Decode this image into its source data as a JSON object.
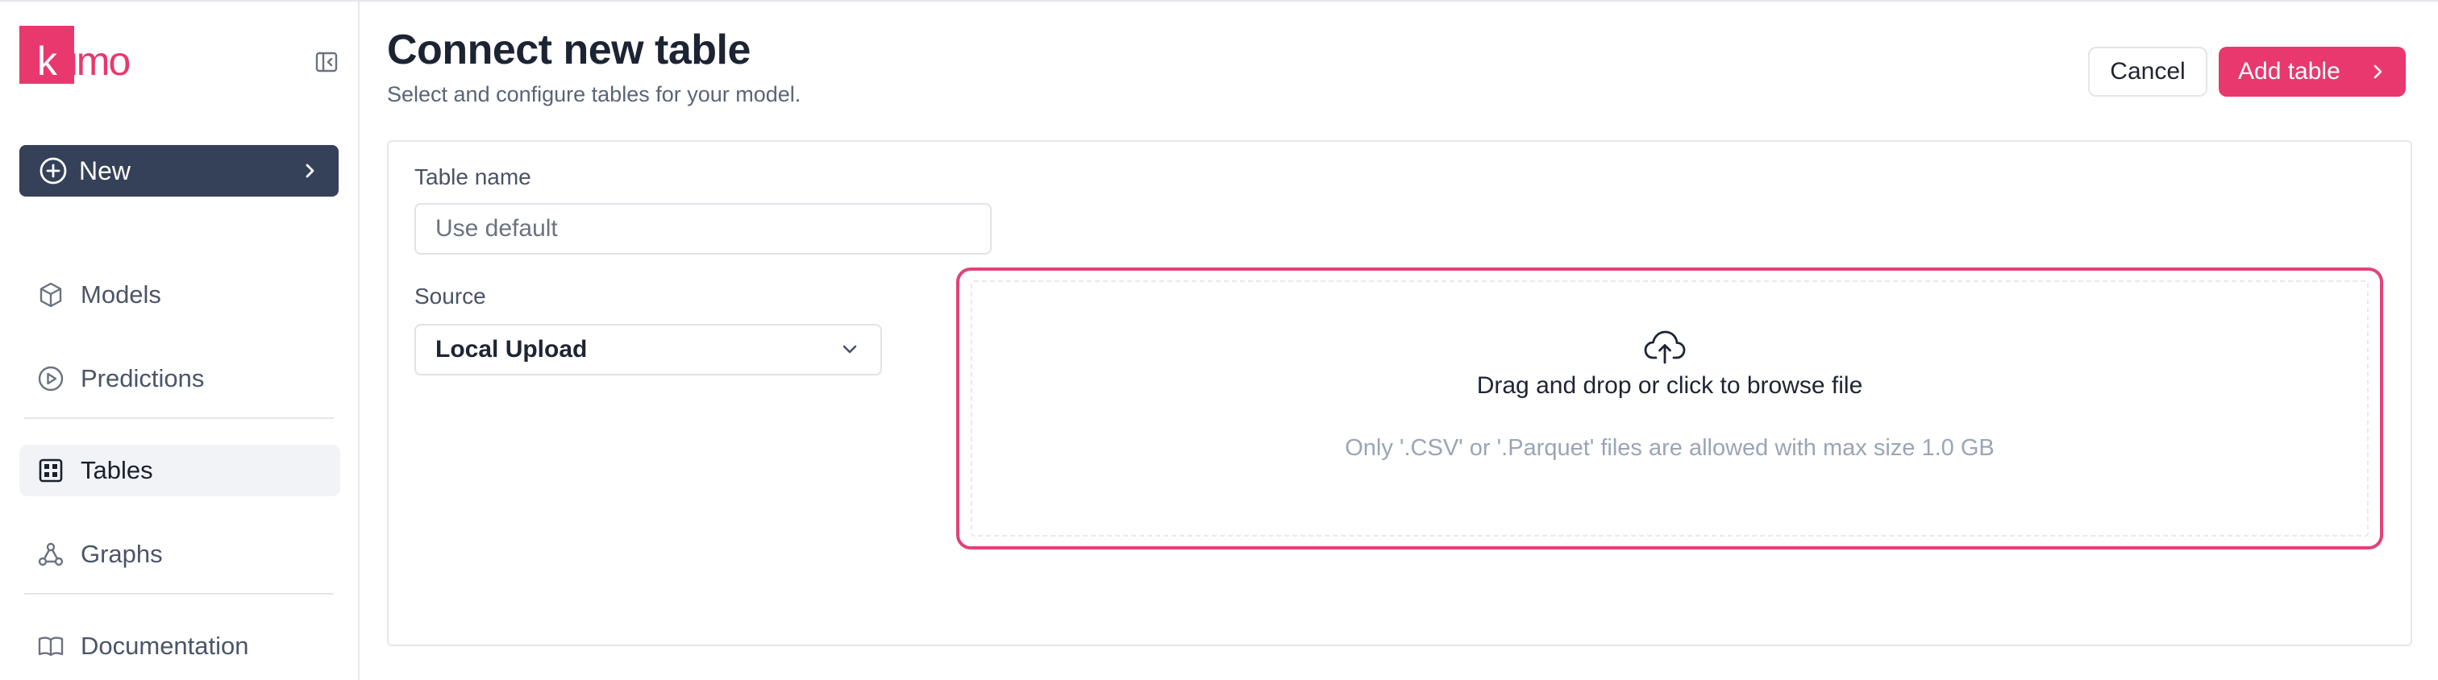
{
  "brand": {
    "logo_text_first": "k",
    "logo_text_rest": "umo",
    "accent_color": "#e8386e"
  },
  "sidebar": {
    "new_button_label": "New",
    "items": [
      {
        "label": "Models",
        "icon": "cube-icon"
      },
      {
        "label": "Predictions",
        "icon": "play-circle-icon"
      },
      {
        "label": "Tables",
        "icon": "table-grid-icon",
        "active": true
      },
      {
        "label": "Graphs",
        "icon": "graph-nodes-icon"
      },
      {
        "label": "Documentation",
        "icon": "book-icon"
      }
    ]
  },
  "header": {
    "title": "Connect new table",
    "subtitle": "Select and configure tables for your model.",
    "cancel_label": "Cancel",
    "add_label": "Add table"
  },
  "form": {
    "table_name_label": "Table name",
    "table_name_placeholder": "Use default",
    "source_label": "Source",
    "source_value": "Local Upload"
  },
  "dropzone": {
    "title": "Drag and drop or click to browse file",
    "hint": "Only '.CSV' or '.Parquet' files are allowed with max size 1.0 GB"
  }
}
